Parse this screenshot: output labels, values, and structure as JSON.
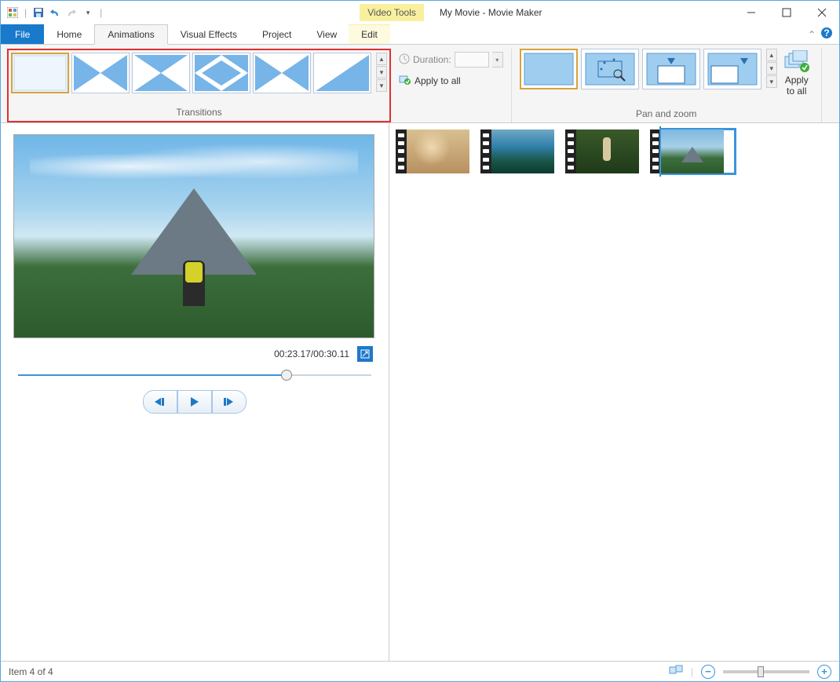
{
  "title": "My Movie - Movie Maker",
  "video_tools_label": "Video Tools",
  "tabs": {
    "file": "File",
    "home": "Home",
    "animations": "Animations",
    "visual_effects": "Visual Effects",
    "project": "Project",
    "view": "View",
    "edit": "Edit"
  },
  "ribbon": {
    "transitions_label": "Transitions",
    "duration_label": "Duration:",
    "duration_value": "",
    "apply_to_all_label": "Apply to all",
    "pan_zoom_label": "Pan and zoom",
    "apply_all_btn": "Apply\nto all"
  },
  "preview": {
    "time": "00:23.17/00:30.11"
  },
  "status": {
    "left": "Item 4 of 4"
  }
}
